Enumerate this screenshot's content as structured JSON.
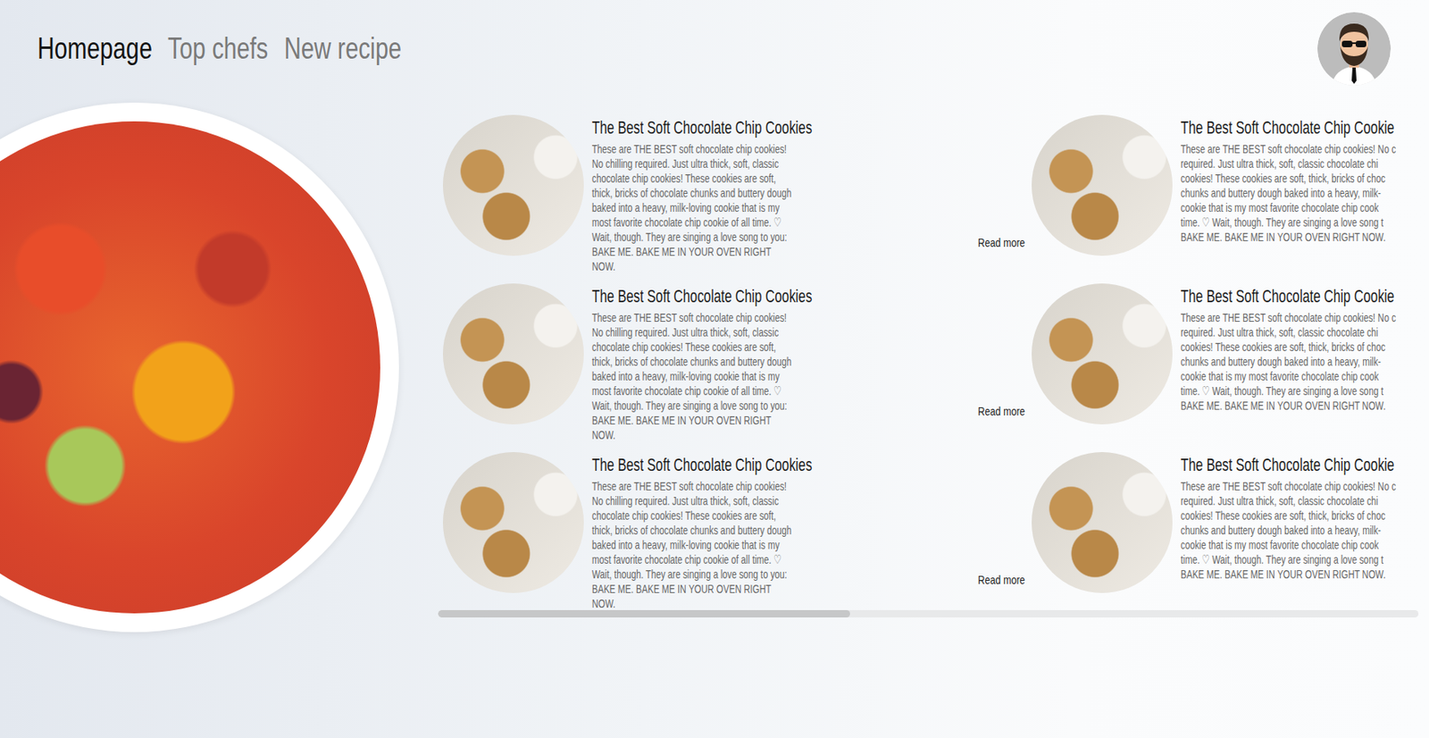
{
  "nav": {
    "items": [
      {
        "label": "Homepage",
        "selected": true
      },
      {
        "label": "Top chefs",
        "selected": false
      },
      {
        "label": "New recipe",
        "selected": false
      }
    ]
  },
  "recipes": [
    {
      "kind": "full",
      "cards": [
        {
          "title": "The Best Soft Chocolate Chip Cookies",
          "description": "These are THE BEST soft chocolate chip cookies! No chilling required. Just ultra thick, soft, classic chocolate chip cookies! These cookies are soft, thick, bricks of chocolate chunks and buttery dough baked into a heavy, milk-loving cookie that is my most favorite chocolate chip cookie of all time. ♡ Wait, though. They are singing a love song to you: BAKE ME. BAKE ME IN YOUR OVEN RIGHT NOW.",
          "action": "Read more"
        },
        {
          "title": "The Best Soft Chocolate Chip Cookies",
          "description": "These are THE BEST soft chocolate chip cookies! No chilling required. Just ultra thick, soft, classic chocolate chip cookies! These cookies are soft, thick, bricks of chocolate chunks and buttery dough baked into a heavy, milk-loving cookie that is my most favorite chocolate chip cookie of all time. ♡ Wait, though. They are singing a love song to you: BAKE ME. BAKE ME IN YOUR OVEN RIGHT NOW.",
          "action": "Read more"
        },
        {
          "title": "The Best Soft Chocolate Chip Cookies",
          "description": "These are THE BEST soft chocolate chip cookies! No chilling required. Just ultra thick, soft, classic chocolate chip cookies! These cookies are soft, thick, bricks of chocolate chunks and buttery dough baked into a heavy, milk-loving cookie that is my most favorite chocolate chip cookie of all time. ♡ Wait, though. They are singing a love song to you: BAKE ME. BAKE ME IN YOUR OVEN RIGHT NOW.",
          "action": "Read more"
        }
      ]
    },
    {
      "kind": "cut",
      "cards": [
        {
          "title": "The Best Soft Chocolate Chip Cookie",
          "lines": [
            "These are THE BEST soft chocolate chip cookies! No c",
            "required. Just ultra thick, soft, classic chocolate chi",
            "cookies! These cookies are soft, thick, bricks of choc",
            "chunks and buttery dough baked into a heavy, milk-",
            "cookie that is my most favorite chocolate chip cook",
            "time. ♡ Wait, though. They are singing a love song t",
            "BAKE ME. BAKE ME IN YOUR OVEN RIGHT NOW."
          ]
        },
        {
          "title": "The Best Soft Chocolate Chip Cookie",
          "lines": [
            "These are THE BEST soft chocolate chip cookies! No c",
            "required. Just ultra thick, soft, classic chocolate chi",
            "cookies! These cookies are soft, thick, bricks of choc",
            "chunks and buttery dough baked into a heavy, milk-",
            "cookie that is my most favorite chocolate chip cook",
            "time. ♡ Wait, though. They are singing a love song t",
            "BAKE ME. BAKE ME IN YOUR OVEN RIGHT NOW."
          ]
        },
        {
          "title": "The Best Soft Chocolate Chip Cookie",
          "lines": [
            "These are THE BEST soft chocolate chip cookies! No c",
            "required. Just ultra thick, soft, classic chocolate chi",
            "cookies! These cookies are soft, thick, bricks of choc",
            "chunks and buttery dough baked into a heavy, milk-",
            "cookie that is my most favorite chocolate chip cook",
            "time. ♡ Wait, though. They are singing a love song t",
            "BAKE ME. BAKE ME IN YOUR OVEN RIGHT NOW."
          ]
        }
      ]
    }
  ],
  "scrollbar": {
    "level": 0.42
  }
}
